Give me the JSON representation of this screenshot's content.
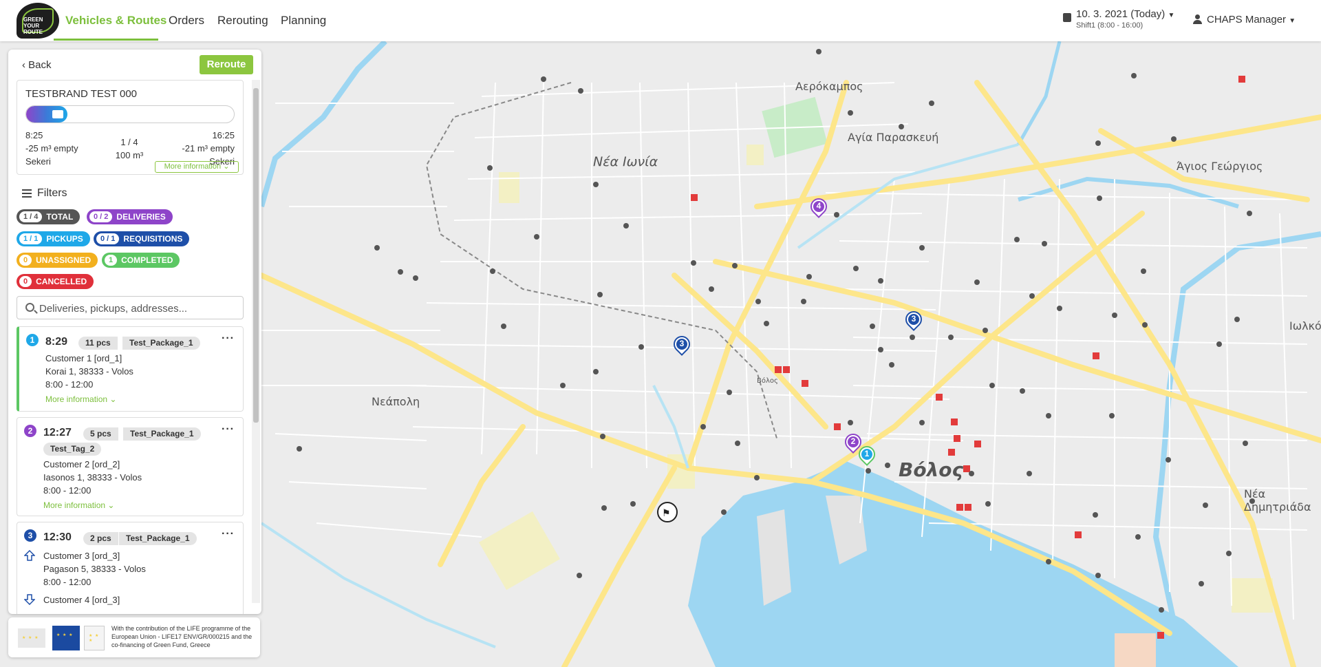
{
  "app": {
    "logo_lines": [
      "GREEN",
      "YOUR",
      "ROUTE"
    ]
  },
  "nav": {
    "items": [
      "Vehicles & Routes",
      "Orders",
      "Rerouting",
      "Planning"
    ],
    "active": "Vehicles & Routes",
    "accent": "#7cbf3c"
  },
  "header": {
    "date": "10. 3. 2021 (Today)",
    "shift": "Shift1 (8:00 - 16:00)",
    "user": "CHAPS Manager"
  },
  "sidebar": {
    "back_label": "Back",
    "reroute_label": "Reroute",
    "vehicle": {
      "name": "TESTBRAND TEST 000",
      "progress": 0.2,
      "start_time": "8:25",
      "start_capacity": "-25 m³ empty",
      "start_place": "Sekeri",
      "stops_progress": "1 / 4",
      "volume": "100 m³",
      "end_time": "16:25",
      "end_capacity": "-21 m³ empty",
      "end_place": "Sekeri",
      "more_info": "More information"
    },
    "filters_title": "Filters",
    "filters": [
      {
        "count": "1 / 4",
        "label": "TOTAL",
        "color": "#555555"
      },
      {
        "count": "0 / 2",
        "label": "DELIVERIES",
        "color": "#8e44c9"
      },
      {
        "count": "1 / 1",
        "label": "PICKUPS",
        "color": "#1fa8e8"
      },
      {
        "count": "0 / 1",
        "label": "REQUISITIONS",
        "color": "#1e4fa8"
      },
      {
        "count": "0",
        "label": "UNASSIGNED",
        "color": "#f2b01e"
      },
      {
        "count": "1",
        "label": "COMPLETED",
        "color": "#5cc763"
      },
      {
        "count": "0",
        "label": "CANCELLED",
        "color": "#e0303a"
      }
    ],
    "search_placeholder": "Deliveries, pickups, addresses...",
    "stops": [
      {
        "num": "1",
        "color": "#1fa8e8",
        "time": "8:29",
        "pcs": "11 pcs",
        "package": "Test_Package_1",
        "customer": "Customer 1 [ord_1]",
        "address": "Korai 1, 38333 - Volos",
        "window": "8:00 - 12:00",
        "more": "More information"
      },
      {
        "num": "2",
        "color": "#8e44c9",
        "time": "12:27",
        "pcs": "5 pcs",
        "package": "Test_Package_1",
        "tag": "Test_Tag_2",
        "customer": "Customer 2 [ord_2]",
        "address": "Iasonos 1, 38333 - Volos",
        "window": "8:00 - 12:00",
        "more": "More information"
      },
      {
        "num": "3",
        "color": "#1e4fa8",
        "time": "12:30",
        "pcs": "2 pcs",
        "package": "Test_Package_1",
        "customer": "Customer 3 [ord_3]",
        "address": "Pagason 5, 38333 - Volos",
        "window": "8:00 - 12:00",
        "customer2": "Customer 4 [ord_3]"
      }
    ]
  },
  "footer": {
    "text": "With the contribution of the LIFE programme of the European Union - LIFE17 ENV/GR/000215 and the co-financing of Green Fund, Greece"
  },
  "map": {
    "labels": [
      {
        "text": "Νέα Ιωνία",
        "style": "normal"
      },
      {
        "text": "Αερόκαμπος",
        "style": "small"
      },
      {
        "text": "Αγία Παρασκευή",
        "style": "small"
      },
      {
        "text": "Άγιος Γεώργιος",
        "style": "small"
      },
      {
        "text": "Νεάπολη",
        "style": "small"
      },
      {
        "text": "Βόλος",
        "style": "big"
      },
      {
        "text": "Νέα Δημητριάδα",
        "style": "small"
      },
      {
        "text": "Ιωλκό",
        "style": "small"
      },
      {
        "text": "Βόλος",
        "style": "tiny"
      }
    ],
    "markers": [
      {
        "num": "4",
        "color": "#8e44c9"
      },
      {
        "num": "3",
        "color": "#1e4fa8"
      },
      {
        "num": "3",
        "color": "#1e4fa8"
      },
      {
        "num": "2",
        "color": "#8e44c9"
      },
      {
        "num": "1",
        "color": "#1fa8e8"
      }
    ]
  }
}
